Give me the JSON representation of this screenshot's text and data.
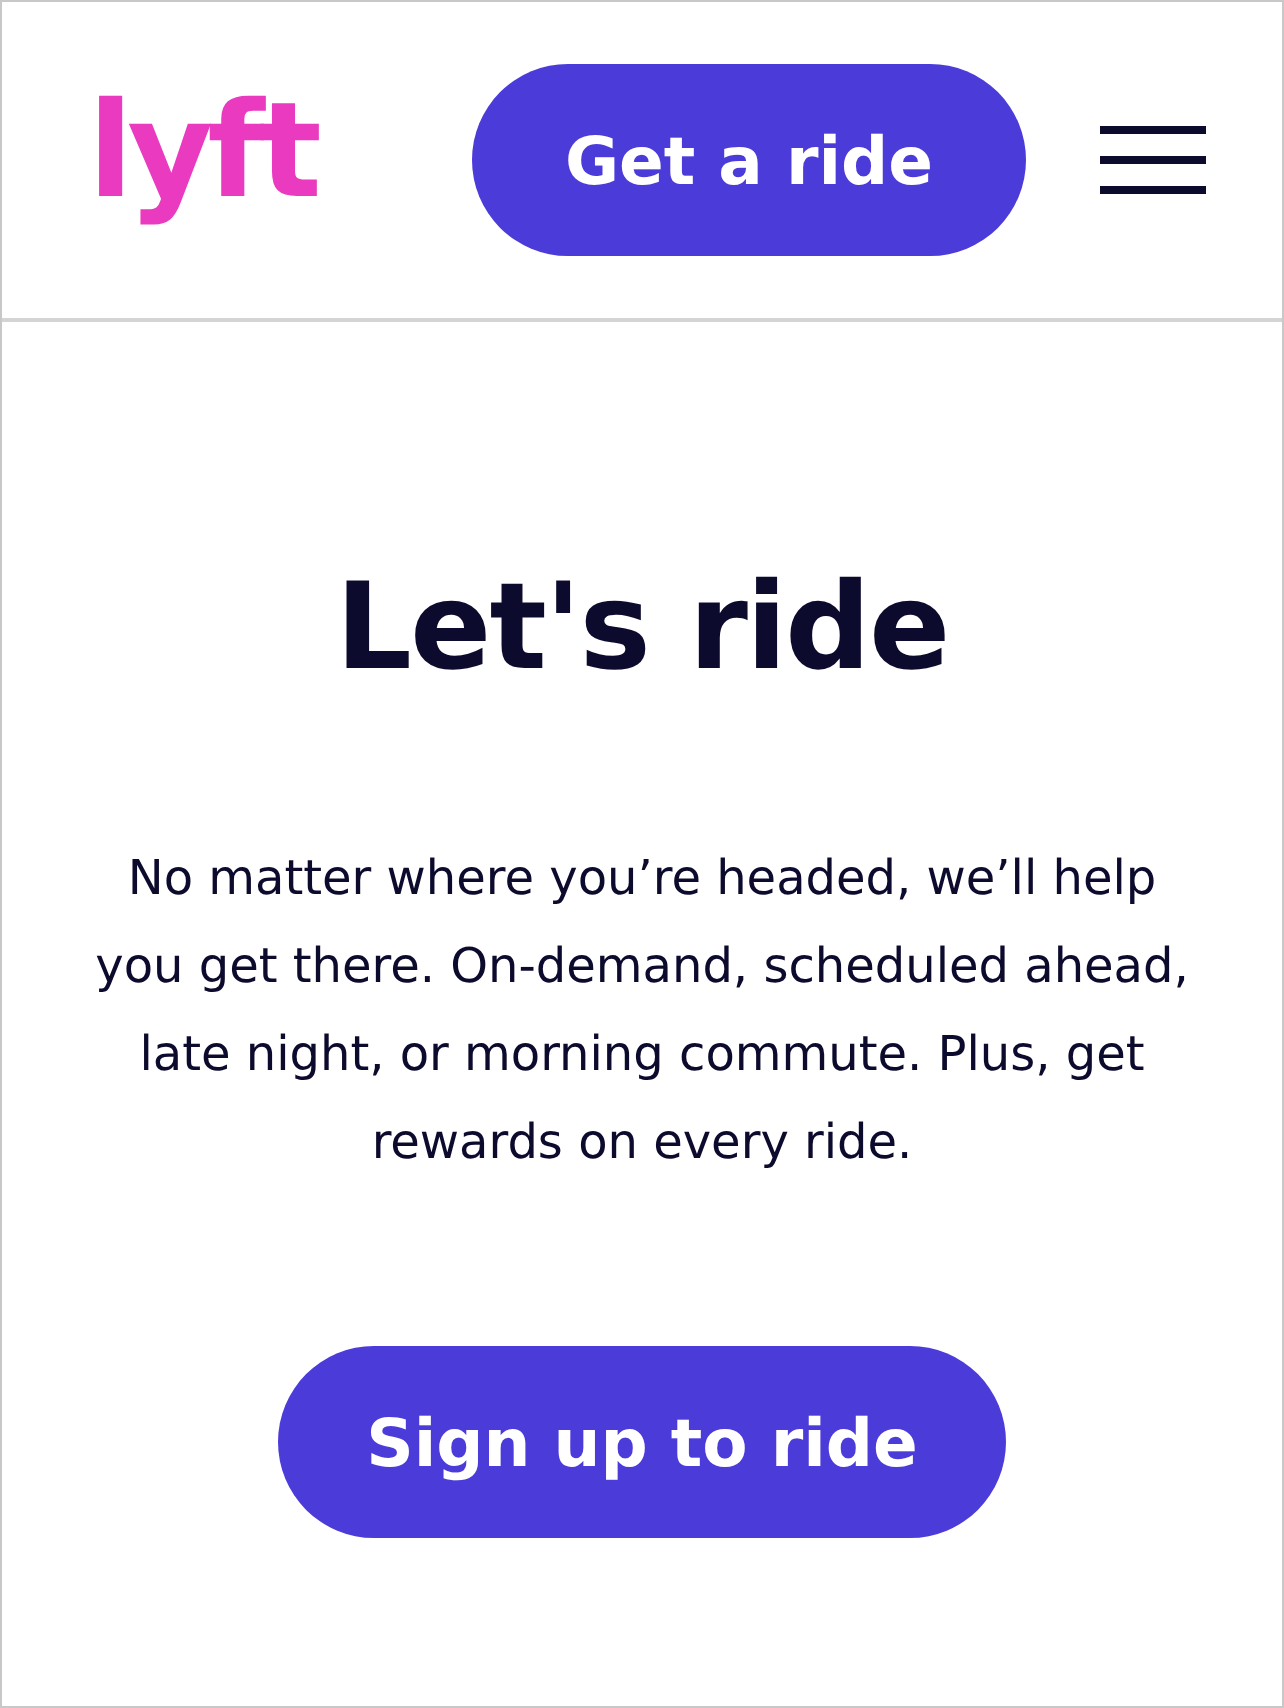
{
  "header": {
    "logo": "lyft",
    "cta": "Get a ride"
  },
  "hero": {
    "title": "Let's ride",
    "text": "No matter where you’re headed, we’ll help you get there. On-demand, scheduled ahead, late night, or morning commute. Plus, get rewards on every ride.",
    "cta": "Sign up to ride"
  }
}
